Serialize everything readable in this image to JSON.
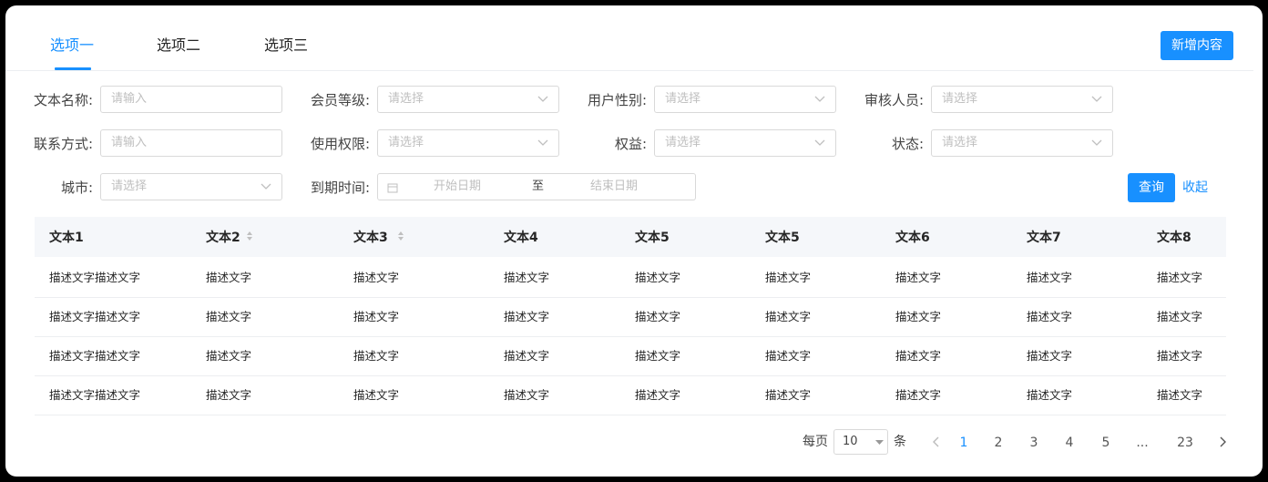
{
  "tabs": [
    {
      "label": "选项一",
      "active": true
    },
    {
      "label": "选项二",
      "active": false
    },
    {
      "label": "选项三",
      "active": false
    }
  ],
  "header": {
    "add_button_label": "新增内容"
  },
  "filters": {
    "text_name": {
      "label": "文本名称:",
      "placeholder": "请输入"
    },
    "member_level": {
      "label": "会员等级:",
      "placeholder": "请选择"
    },
    "user_gender": {
      "label": "用户性别:",
      "placeholder": "请选择"
    },
    "reviewer": {
      "label": "审核人员:",
      "placeholder": "请选择"
    },
    "contact": {
      "label": "联系方式:",
      "placeholder": "请输入"
    },
    "permission": {
      "label": "使用权限:",
      "placeholder": "请选择"
    },
    "rights": {
      "label": "权益:",
      "placeholder": "请选择"
    },
    "status": {
      "label": "状态:",
      "placeholder": "请选择"
    },
    "city": {
      "label": "城市:",
      "placeholder": "请选择"
    },
    "expiry": {
      "label": "到期时间:",
      "start_placeholder": "开始日期",
      "separator": "至",
      "end_placeholder": "结束日期"
    },
    "query_label": "查询",
    "collapse_label": "收起"
  },
  "table": {
    "columns": [
      "文本1",
      "文本2",
      "文本3",
      "文本4",
      "文本5",
      "文本5",
      "文本6",
      "文本7",
      "文本8"
    ],
    "rows": [
      [
        "描述文字描述文字",
        "描述文字",
        "描述文字",
        "描述文字",
        "描述文字",
        "描述文字",
        "描述文字",
        "描述文字",
        "描述文字"
      ],
      [
        "描述文字描述文字",
        "描述文字",
        "描述文字",
        "描述文字",
        "描述文字",
        "描述文字",
        "描述文字",
        "描述文字",
        "描述文字"
      ],
      [
        "描述文字描述文字",
        "描述文字",
        "描述文字",
        "描述文字",
        "描述文字",
        "描述文字",
        "描述文字",
        "描述文字",
        "描述文字"
      ],
      [
        "描述文字描述文字",
        "描述文字",
        "描述文字",
        "描述文字",
        "描述文字",
        "描述文字",
        "描述文字",
        "描述文字",
        "描述文字"
      ]
    ]
  },
  "pagination": {
    "per_page_prefix": "每页",
    "page_size": "10",
    "per_page_suffix": "条",
    "pages": [
      "1",
      "2",
      "3",
      "4",
      "5",
      "...",
      "23"
    ],
    "current": "1"
  },
  "colors": {
    "accent": "#1890ff",
    "header_bg": "#f5f7fa",
    "border": "#d9d9d9"
  }
}
